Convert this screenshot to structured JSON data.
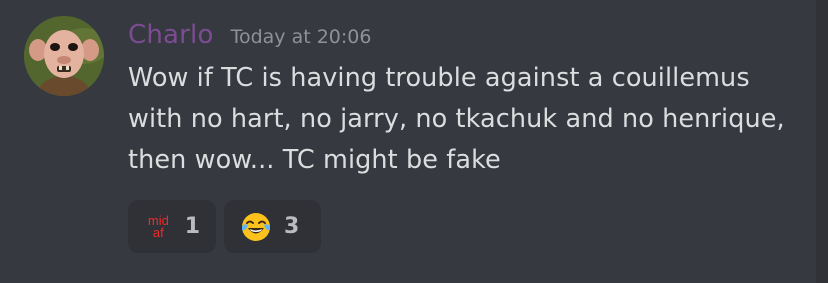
{
  "message": {
    "author": "Charlo",
    "timestamp": "Today at 20:06",
    "lines": [
      "Wow if TC is having trouble against a couillemus",
      "with no hart, no jarry, no tkachuk and no henrique,",
      "then wow... TC might be fake"
    ]
  },
  "reactions": [
    {
      "emoji_name": "mid-af-emoji",
      "emoji_text_top": "mid",
      "emoji_text_bottom": "af",
      "count": "1"
    },
    {
      "emoji_name": "joy-emoji",
      "count": "3"
    }
  ],
  "colors": {
    "background": "#36393f",
    "username": "#7c4c93",
    "text": "#dcddde",
    "timestamp": "#8e9297",
    "reaction_bg": "#2f3136",
    "mid_af": "#ed2b2b"
  }
}
